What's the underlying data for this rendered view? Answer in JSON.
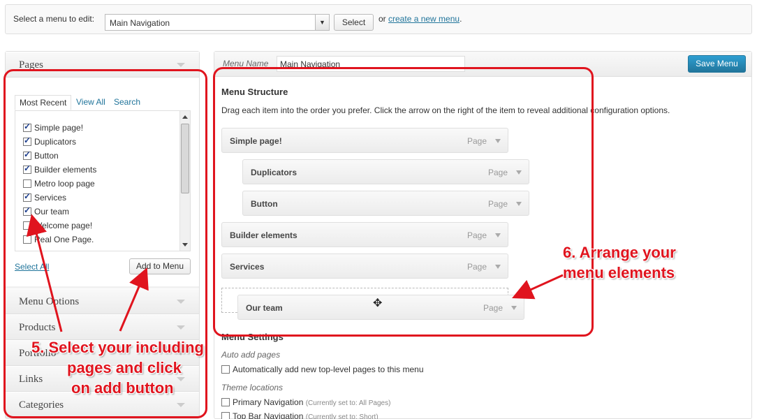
{
  "topbar": {
    "label": "Select a menu to edit:",
    "selected_menu": "Main Navigation",
    "select_button": "Select",
    "or_text": "or",
    "create_link": "create a new menu",
    "period": "."
  },
  "left": {
    "pages_title": "Pages",
    "tabs": [
      "Most Recent",
      "View All",
      "Search"
    ],
    "pages": [
      {
        "label": "Simple page!",
        "checked": true
      },
      {
        "label": "Duplicators",
        "checked": true
      },
      {
        "label": "Button",
        "checked": true
      },
      {
        "label": "Builder elements",
        "checked": true
      },
      {
        "label": "Metro loop page",
        "checked": false
      },
      {
        "label": "Services",
        "checked": true
      },
      {
        "label": "Our team",
        "checked": true
      },
      {
        "label": "Welcome page!",
        "checked": false
      },
      {
        "label": "Real One Page.",
        "checked": false
      }
    ],
    "select_all": "Select All",
    "add_button": "Add to Menu",
    "sections": [
      "Menu Options",
      "Products",
      "Portfolio",
      "Links",
      "Categories"
    ]
  },
  "right": {
    "menu_name_label": "Menu Name",
    "menu_name_value": "Main Navigation",
    "save_button": "Save Menu",
    "structure_title": "Menu Structure",
    "structure_desc": "Drag each item into the order you prefer. Click the arrow on the right of the item to reveal additional configuration options.",
    "items": [
      {
        "name": "Simple page!",
        "type": "Page"
      },
      {
        "name": "Duplicators",
        "type": "Page"
      },
      {
        "name": "Button",
        "type": "Page"
      },
      {
        "name": "Builder elements",
        "type": "Page"
      },
      {
        "name": "Services",
        "type": "Page"
      },
      {
        "name": "Our team",
        "type": "Page"
      }
    ],
    "settings_title": "Menu Settings",
    "auto_add_label": "Auto add pages",
    "auto_add_option": "Automatically add new top-level pages to this menu",
    "theme_locations_label": "Theme locations",
    "locations": [
      {
        "name": "Primary Navigation",
        "note": "(Currently set to: All Pages)"
      },
      {
        "name": "Top Bar Navigation",
        "note": "(Currently set to: Short)"
      }
    ]
  },
  "annotations": {
    "step5": [
      "5. Select your including",
      "pages and click",
      "on add button"
    ],
    "step6": [
      "6. Arrange your",
      "menu elements"
    ]
  },
  "colors": {
    "annotation_red": "#e0141e",
    "link_blue": "#21759b",
    "save_blue": "#21759b"
  }
}
